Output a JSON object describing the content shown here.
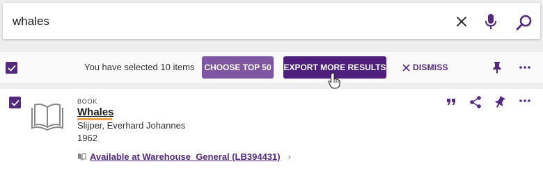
{
  "search": {
    "query": "whales",
    "clear_icon": "close-icon",
    "mic_icon": "microphone-icon",
    "search_icon": "search-icon"
  },
  "selection_bar": {
    "selected_text": "You have selected 10 items",
    "choose_top_label": "CHOOSE TOP 50",
    "export_label": "EXPORT MORE RESULTS",
    "dismiss_label": "DISMISS",
    "pin_icon": "pin-icon",
    "more_icon": "more-options-icon",
    "checked": true
  },
  "result": {
    "type": "BOOK",
    "title": "Whales",
    "author": "Slijper, Everhard Johannes",
    "year": "1962",
    "availability": "Available at Warehouse  General (LB394431)",
    "actions": [
      "citation-icon",
      "share-icon",
      "pin-icon",
      "more-options-icon"
    ],
    "checked": true
  },
  "colors": {
    "primary": "#53287d",
    "secondary": "#7e56a1",
    "highlight": "#f0a24c"
  }
}
